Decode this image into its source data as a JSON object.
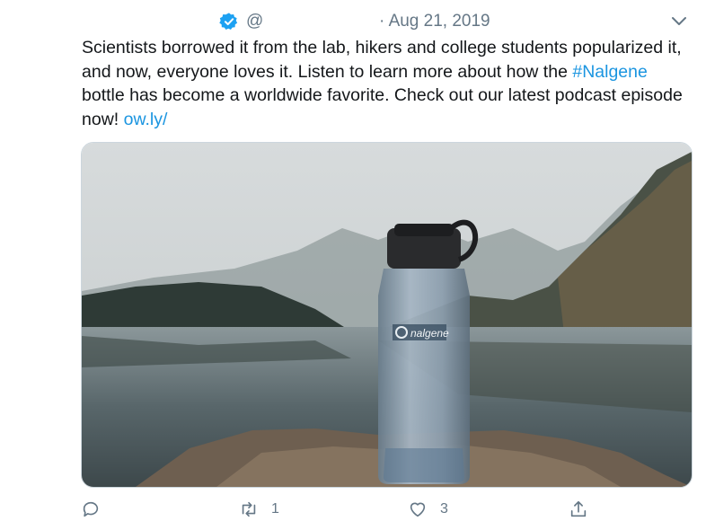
{
  "tweet": {
    "handle": "@",
    "separator": "·",
    "date": "Aug 21, 2019",
    "text_part1": "Scientists borrowed it from the lab, hikers and college students popularized it, and now, everyone loves it. Listen to learn more about how the ",
    "hashtag": "#Nalgene",
    "text_part2": " bottle has become a worldwide favorite. Check out our latest podcast episode now! ",
    "link": "ow.ly/",
    "media": {
      "bottle_brand": "nalgene"
    }
  },
  "actions": {
    "reply_count": "",
    "retweet_count": "1",
    "like_count": "3"
  },
  "colors": {
    "link": "#1b95e0",
    "muted": "#657786",
    "verified": "#1da1f2"
  },
  "icons": [
    "verified-badge-icon",
    "chevron-down-icon",
    "reply-icon",
    "retweet-icon",
    "like-icon",
    "share-icon"
  ]
}
